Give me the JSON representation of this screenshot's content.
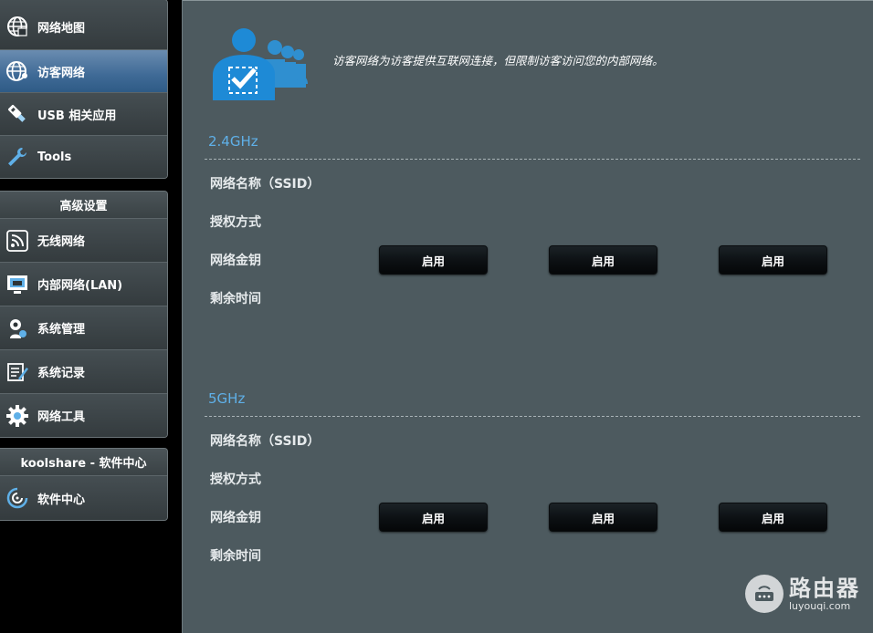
{
  "sidebar": {
    "general": [
      {
        "label": "网络地图",
        "icon": "globe-icon"
      },
      {
        "label": "访客网络",
        "icon": "globe-icon"
      },
      {
        "label": "USB 相关应用",
        "icon": "usb-icon"
      },
      {
        "label": "Tools",
        "icon": "wrench-icon"
      }
    ],
    "advanced_title": "高级设置",
    "advanced": [
      {
        "label": "无线网络",
        "icon": "wifi-icon"
      },
      {
        "label": "内部网络(LAN)",
        "icon": "lan-icon"
      },
      {
        "label": "系统管理",
        "icon": "admin-gear-icon"
      },
      {
        "label": "系统记录",
        "icon": "log-icon"
      },
      {
        "label": "网络工具",
        "icon": "gear-icon"
      }
    ],
    "software_title": "koolshare - 软件中心",
    "software": [
      {
        "label": "软件中心",
        "icon": "swirl-icon"
      }
    ]
  },
  "main": {
    "description": "访客网络为访客提供互联网连接，但限制访客访问您的内部网络。",
    "bands": [
      {
        "title": "2.4GHz",
        "labels": [
          "网络名称（SSID）",
          "授权方式",
          "网络金钥",
          "剩余时间"
        ],
        "buttons": [
          "启用",
          "启用",
          "启用"
        ]
      },
      {
        "title": "5GHz",
        "labels": [
          "网络名称（SSID）",
          "授权方式",
          "网络金钥",
          "剩余时间"
        ],
        "buttons": [
          "启用",
          "启用",
          "启用"
        ]
      }
    ]
  },
  "watermark": {
    "title": "路由器",
    "subtitle": "luyouqi.com"
  },
  "colors": {
    "active_item": "#3f6a96",
    "band_title": "#5fb0e8",
    "content_bg": "#4d5a5f"
  }
}
